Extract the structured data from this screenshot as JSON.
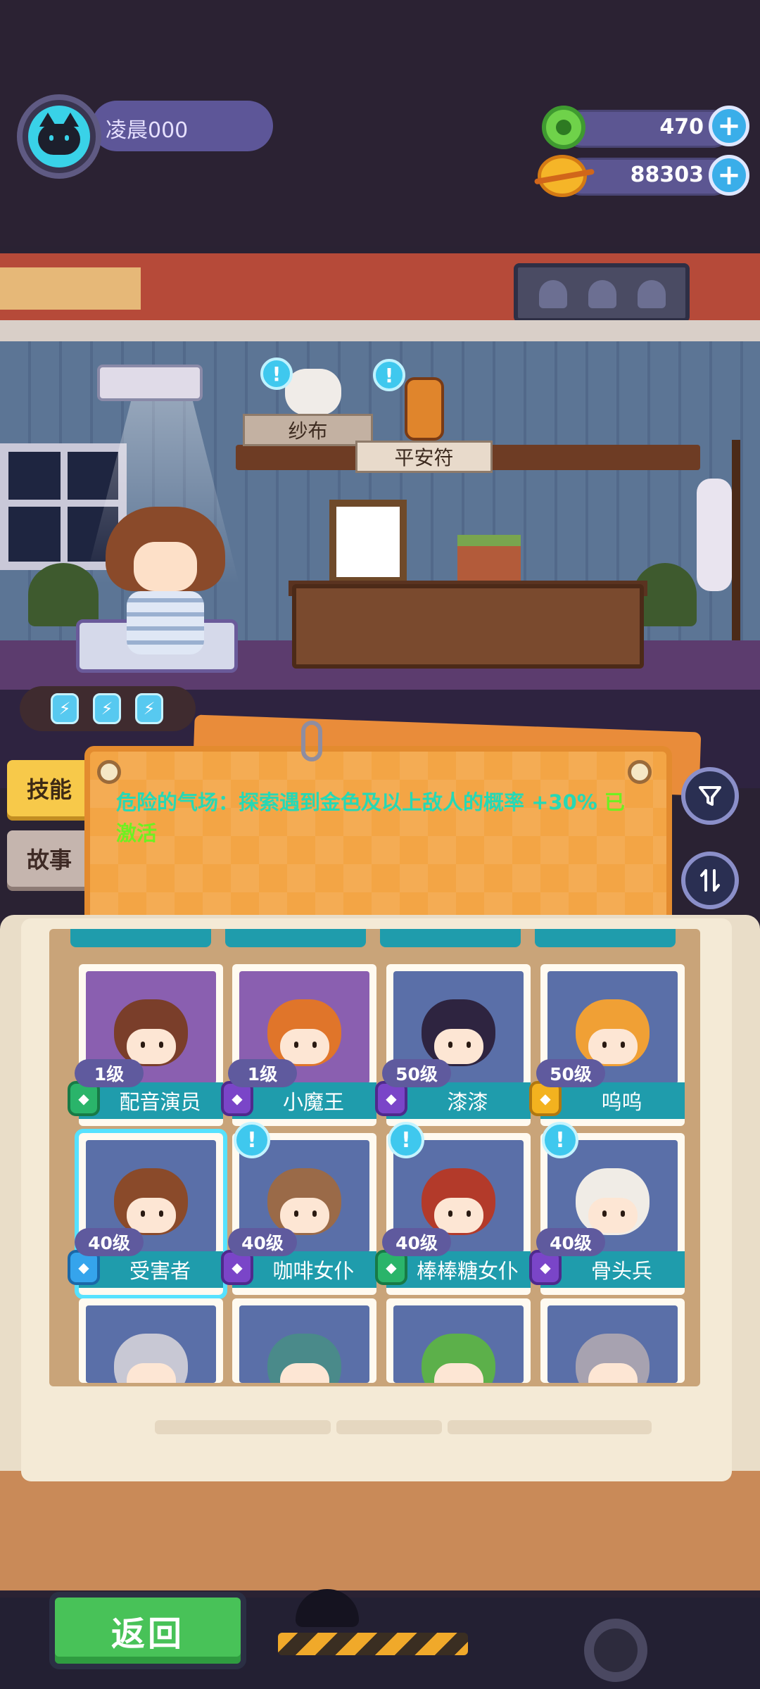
{
  "player": {
    "name": "凌晨000",
    "avatar_icon": "cat-face-icon"
  },
  "resources": [
    {
      "name": "gem",
      "icon": "green-gem-icon",
      "value": "470",
      "plus": "+"
    },
    {
      "name": "coin",
      "icon": "planet-coin-icon",
      "value": "88303",
      "plus": "+"
    }
  ],
  "scene": {
    "tags": [
      "纱布",
      "平安符"
    ],
    "alert_mark": "!",
    "energy_count": 3
  },
  "tabs": {
    "skill": "技能",
    "story": "故事"
  },
  "skill_panel": {
    "description": "危险的气场：探索遇到金色及以上敌人的概率 +30%",
    "status": "已激活",
    "filter_icon": "filter-funnel-icon",
    "sort_icon": "sort-arrows-icon"
  },
  "roster": {
    "rows": [
      [
        {
          "name": "配音演员",
          "level": "1级",
          "badge": "green",
          "art_bg": "#8a5fb0",
          "hair": "#7a3e2a"
        },
        {
          "name": "小魔王",
          "level": "1级",
          "badge": "purple",
          "art_bg": "#8a5fb0",
          "hair": "#e0752a"
        },
        {
          "name": "漆漆",
          "level": "50级",
          "badge": "purple",
          "art_bg": "#5a6fa8",
          "hair": "#2e2440"
        },
        {
          "name": "呜呜",
          "level": "50级",
          "badge": "gold",
          "art_bg": "#5a6fa8",
          "hair": "#f0a035"
        }
      ],
      [
        {
          "name": "受害者",
          "level": "40级",
          "badge": "blue",
          "art_bg": "#5a6fa8",
          "hair": "#8a4a2a",
          "selected": true
        },
        {
          "name": "咖啡女仆",
          "level": "40级",
          "badge": "purple",
          "art_bg": "#5a6fa8",
          "hair": "#9a6a48",
          "alert": true
        },
        {
          "name": "棒棒糖女仆",
          "level": "40级",
          "badge": "green",
          "art_bg": "#5a6fa8",
          "hair": "#b33a2a",
          "alert": true
        },
        {
          "name": "骨头兵",
          "level": "40级",
          "badge": "purple",
          "art_bg": "#5a6fa8",
          "hair": "#f0ece6",
          "alert": true
        }
      ],
      [
        {
          "hair": "#c8c8d4",
          "art_bg": "#5a6fa8"
        },
        {
          "hair": "#4a8a8a",
          "art_bg": "#5a6fa8"
        },
        {
          "hair": "#5cb04a",
          "art_bg": "#5a6fa8"
        },
        {
          "hair": "#a7a2b0",
          "art_bg": "#5a6fa8"
        }
      ]
    ]
  },
  "bottom": {
    "back_label": "返回"
  }
}
